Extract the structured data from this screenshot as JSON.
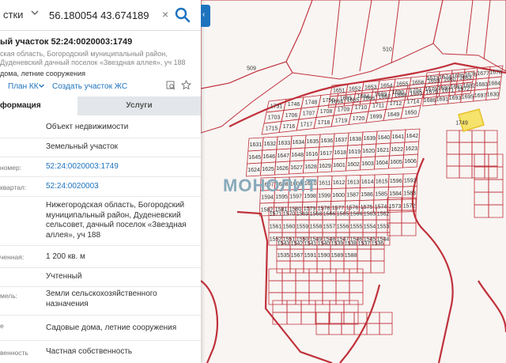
{
  "search": {
    "type_label": "стки",
    "query": "56.180054 43.674189",
    "clear_glyph": "×"
  },
  "collapse_glyph": "‹",
  "object": {
    "title": "ый участок 52:24:0020003:1749",
    "address": "ская область, Богородский муниципальный район, Дуденевский дачный поселок «Звездная аллея», уч 188",
    "purpose": "дома, летние сооружения"
  },
  "actions": {
    "plan_label": "План КК",
    "create_label": "Создать участок ЖС"
  },
  "tabs": [
    {
      "label": "формация"
    },
    {
      "label": "Услуги"
    }
  ],
  "info_rows": [
    {
      "label": "",
      "value": "Объект недвижимости"
    },
    {
      "label": "",
      "value": "Земельный участок"
    },
    {
      "label": "номер:",
      "value": "52:24:0020003:1749"
    },
    {
      "label": "квартал:",
      "value": "52:24:0020003"
    },
    {
      "label": "",
      "value": "Нижегородская область, Богородский муниципальный район, Дуденевский сельсовет, дачный поселок «Звездная аллея», уч 188"
    },
    {
      "label": "ченная:",
      "value": "1 200 кв. м"
    },
    {
      "label": "",
      "value": "Учтенный"
    },
    {
      "label": "мель:",
      "value": "Земли сельскохозяйственного назначения"
    },
    {
      "label": "е",
      "value": "Садовые дома, летние сооружения"
    },
    {
      "label": "венность",
      "value": "Частная собственность"
    }
  ],
  "map": {
    "watermark": "МОНОЛИТ",
    "parcel_labels": [
      "510",
      "509",
      "1731",
      "1746",
      "1748",
      "1749",
      "1750",
      "1685",
      "1694",
      "1689",
      "1690",
      "1704",
      "1703",
      "1706",
      "1707",
      "1708",
      "1709",
      "1710",
      "1711",
      "1712",
      "1714",
      "1715",
      "1716",
      "1717",
      "1718",
      "1719",
      "1720",
      "1699",
      "1649",
      "1650",
      "1651",
      "1652",
      "1653",
      "1654",
      "1655",
      "1656",
      "1659",
      "1660",
      "1663",
      "1664",
      "1665",
      "1666",
      "1667",
      "1668",
      "1669",
      "1670",
      "1671",
      "1672",
      "1673",
      "1674",
      "1675",
      "1676",
      "1677",
      "1678",
      "1679",
      "1680",
      "1681",
      "1682",
      "1683",
      "1684",
      "1686",
      "1691",
      "1693",
      "1695",
      "1697",
      "1630",
      "1631",
      "1632",
      "1633",
      "1634",
      "1635",
      "1636",
      "1637",
      "1638",
      "1639",
      "1640",
      "1641",
      "1642",
      "1645",
      "1646",
      "1647",
      "1648",
      "1616",
      "1617",
      "1618",
      "1619",
      "1620",
      "1621",
      "1622",
      "1623",
      "1624",
      "1625",
      "1626",
      "1627",
      "1628",
      "1629",
      "1601",
      "1602",
      "1603",
      "1604",
      "1605",
      "1606",
      "1607",
      "1608",
      "1609",
      "1610",
      "1611",
      "1612",
      "1613",
      "1614",
      "1615",
      "1596",
      "1593",
      "1594",
      "1595",
      "1597",
      "1598",
      "1599",
      "1600",
      "1587",
      "1586",
      "1585",
      "1584",
      "1583",
      "1582",
      "1581",
      "1580",
      "1579",
      "1578",
      "1577",
      "1576",
      "1575",
      "1574",
      "1573",
      "1572",
      "1571",
      "1570",
      "1569",
      "1568",
      "1566",
      "1565",
      "1564",
      "1563",
      "1562",
      "1561",
      "1560",
      "1559",
      "1558",
      "1557",
      "1556",
      "1555",
      "1554",
      "1553",
      "1552",
      "1551",
      "1550",
      "1549",
      "1548",
      "1547",
      "1546",
      "1545",
      "1544",
      "1543",
      "1542",
      "1541",
      "1540",
      "1539",
      "1538",
      "1537",
      "1536",
      "1535",
      "1567",
      "1591",
      "1590",
      "1589",
      "1588"
    ]
  }
}
